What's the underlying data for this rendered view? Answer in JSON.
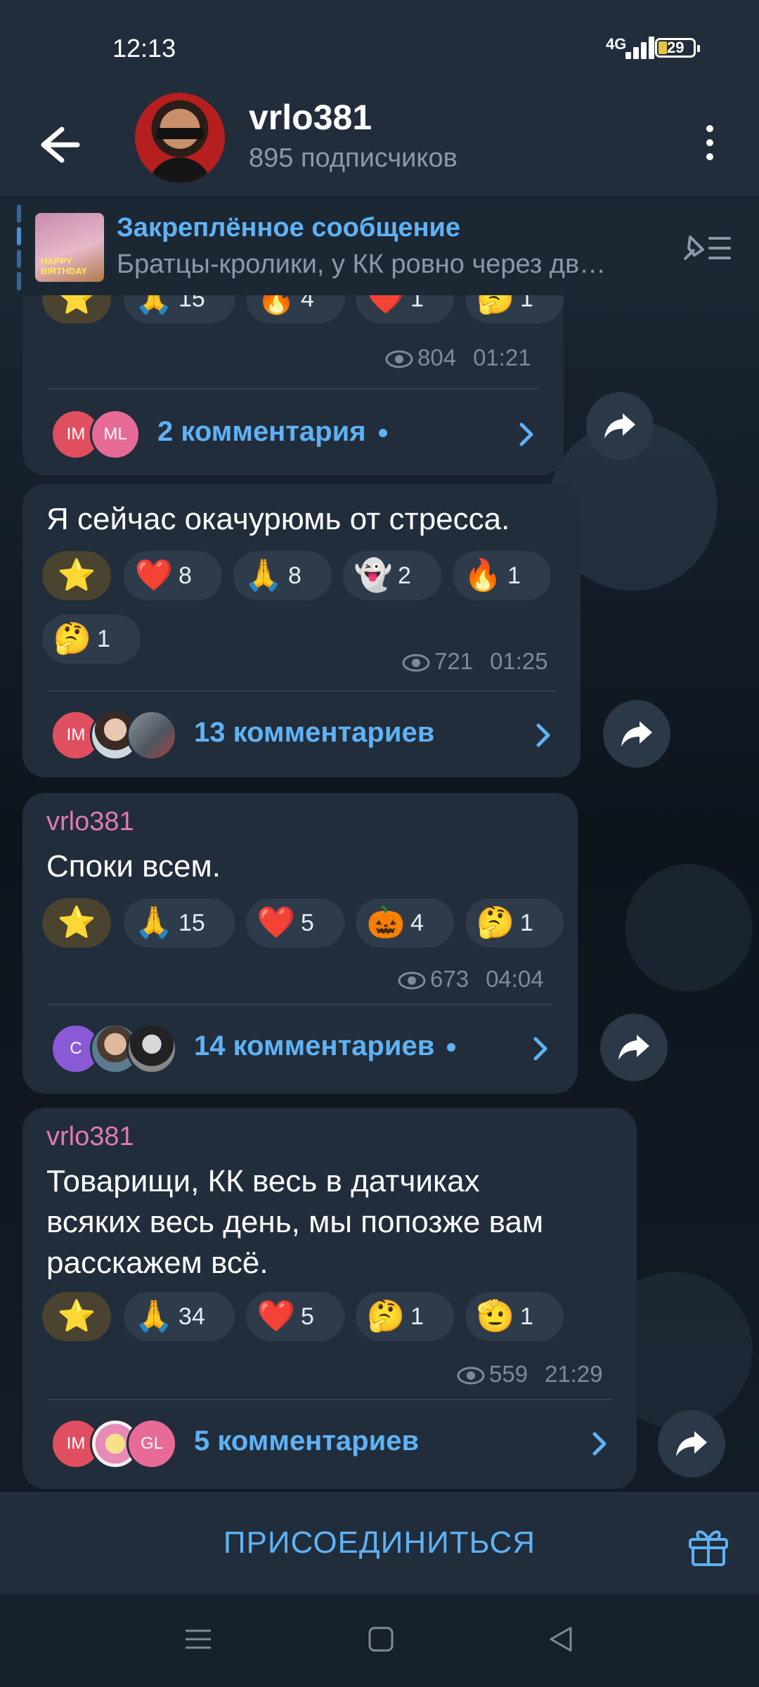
{
  "status_bar": {
    "time": "12:13",
    "network": "4G",
    "battery": "29"
  },
  "header": {
    "title": "vrlo381",
    "subtitle": "895 подписчиков"
  },
  "pinned": {
    "title": "Закреплённое сообщение",
    "text": "Братцы-кролики, у КК ровно через дв…",
    "thumb_text": "HAPPY BIRTHDAY"
  },
  "messages": [
    {
      "author": "",
      "text": "",
      "reactions": [
        {
          "emoji": "⭐",
          "count": ""
        },
        {
          "emoji": "🙏",
          "count": "15"
        },
        {
          "emoji": "🔥",
          "count": "4"
        },
        {
          "emoji": "❤️",
          "count": "1"
        },
        {
          "emoji": "🤔",
          "count": "1"
        }
      ],
      "views": "804",
      "time": "01:21",
      "comment_avatars": [
        "IM",
        "ML"
      ],
      "comments": "2 комментария"
    },
    {
      "author": "",
      "text": "Я сейчас окачурюмь от стресса.",
      "reactions": [
        {
          "emoji": "⭐",
          "count": ""
        },
        {
          "emoji": "❤️",
          "count": "8"
        },
        {
          "emoji": "🙏",
          "count": "8"
        },
        {
          "emoji": "👻",
          "count": "2"
        },
        {
          "emoji": "🔥",
          "count": "1"
        },
        {
          "emoji": "🤔",
          "count": "1"
        }
      ],
      "views": "721",
      "time": "01:25",
      "comment_avatars": [
        "IM",
        "",
        ""
      ],
      "comments": "13 комментариев"
    },
    {
      "author": "vrlo381",
      "text": "Споки всем.",
      "reactions": [
        {
          "emoji": "⭐",
          "count": ""
        },
        {
          "emoji": "🙏",
          "count": "15"
        },
        {
          "emoji": "❤️",
          "count": "5"
        },
        {
          "emoji": "🎃",
          "count": "4"
        },
        {
          "emoji": "🤔",
          "count": "1"
        }
      ],
      "views": "673",
      "time": "04:04",
      "comment_avatars": [
        "C",
        "",
        ""
      ],
      "comments": "14 комментариев"
    },
    {
      "author": "vrlo381",
      "text_lines": [
        "Товарищи, КК весь в датчиках",
        "всяких весь день, мы попозже вам",
        "расскажем всё."
      ],
      "reactions": [
        {
          "emoji": "⭐",
          "count": ""
        },
        {
          "emoji": "🙏",
          "count": "34"
        },
        {
          "emoji": "❤️",
          "count": "5"
        },
        {
          "emoji": "🤔",
          "count": "1"
        },
        {
          "emoji": "🫡",
          "count": "1"
        }
      ],
      "views": "559",
      "time": "21:29",
      "comment_avatars": [
        "IM",
        "",
        "GL"
      ],
      "comments": "5 комментариев"
    }
  ],
  "bottom": {
    "join_label": "ПРИСОЕДИНИТЬСЯ"
  },
  "icons": {
    "back": "arrow-left-icon",
    "more": "more-vert-icon",
    "unpin": "pin-list-icon",
    "share": "share-icon",
    "gift": "gift-icon",
    "views": "eye-icon",
    "chevron": "chevron-right-icon"
  },
  "colors": {
    "accent": "#5fb2f5",
    "author": "#e07bb0",
    "bubble": "#212d3b",
    "background": "#0f1620"
  }
}
